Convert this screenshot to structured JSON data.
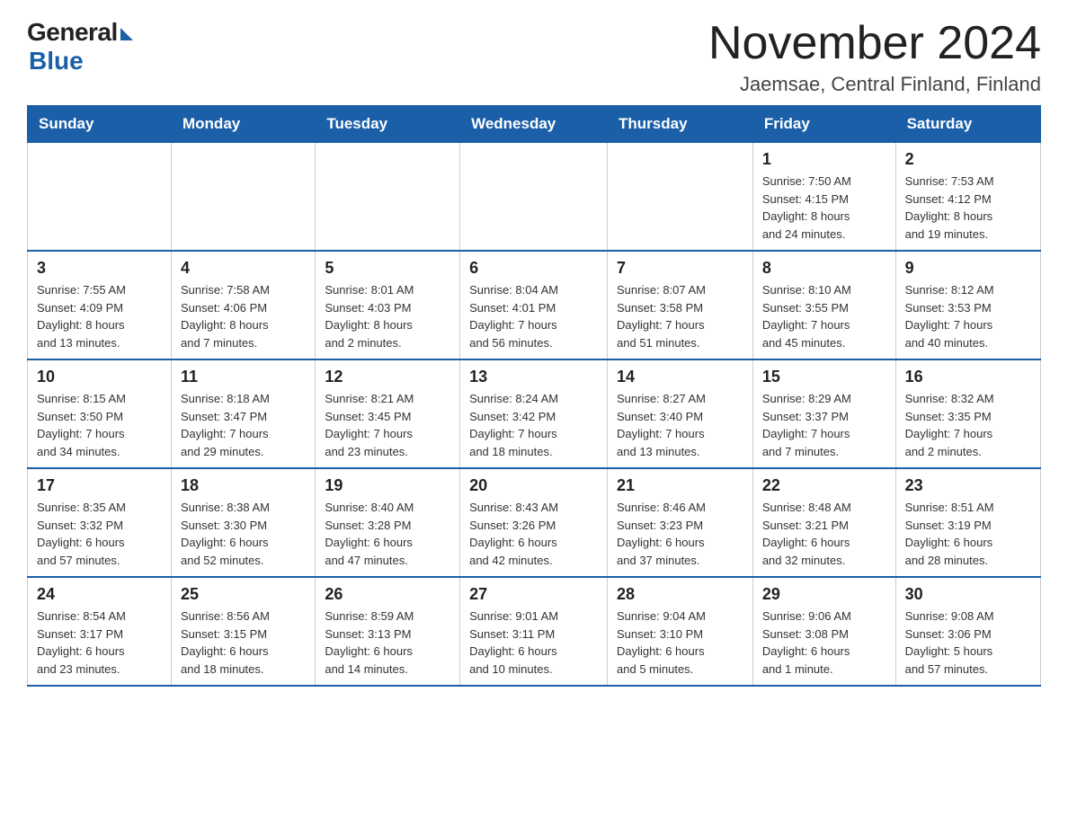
{
  "logo": {
    "general": "General",
    "blue": "Blue"
  },
  "header": {
    "title": "November 2024",
    "subtitle": "Jaemsae, Central Finland, Finland"
  },
  "weekdays": [
    "Sunday",
    "Monday",
    "Tuesday",
    "Wednesday",
    "Thursday",
    "Friday",
    "Saturday"
  ],
  "weeks": [
    [
      {
        "day": "",
        "info": ""
      },
      {
        "day": "",
        "info": ""
      },
      {
        "day": "",
        "info": ""
      },
      {
        "day": "",
        "info": ""
      },
      {
        "day": "",
        "info": ""
      },
      {
        "day": "1",
        "info": "Sunrise: 7:50 AM\nSunset: 4:15 PM\nDaylight: 8 hours\nand 24 minutes."
      },
      {
        "day": "2",
        "info": "Sunrise: 7:53 AM\nSunset: 4:12 PM\nDaylight: 8 hours\nand 19 minutes."
      }
    ],
    [
      {
        "day": "3",
        "info": "Sunrise: 7:55 AM\nSunset: 4:09 PM\nDaylight: 8 hours\nand 13 minutes."
      },
      {
        "day": "4",
        "info": "Sunrise: 7:58 AM\nSunset: 4:06 PM\nDaylight: 8 hours\nand 7 minutes."
      },
      {
        "day": "5",
        "info": "Sunrise: 8:01 AM\nSunset: 4:03 PM\nDaylight: 8 hours\nand 2 minutes."
      },
      {
        "day": "6",
        "info": "Sunrise: 8:04 AM\nSunset: 4:01 PM\nDaylight: 7 hours\nand 56 minutes."
      },
      {
        "day": "7",
        "info": "Sunrise: 8:07 AM\nSunset: 3:58 PM\nDaylight: 7 hours\nand 51 minutes."
      },
      {
        "day": "8",
        "info": "Sunrise: 8:10 AM\nSunset: 3:55 PM\nDaylight: 7 hours\nand 45 minutes."
      },
      {
        "day": "9",
        "info": "Sunrise: 8:12 AM\nSunset: 3:53 PM\nDaylight: 7 hours\nand 40 minutes."
      }
    ],
    [
      {
        "day": "10",
        "info": "Sunrise: 8:15 AM\nSunset: 3:50 PM\nDaylight: 7 hours\nand 34 minutes."
      },
      {
        "day": "11",
        "info": "Sunrise: 8:18 AM\nSunset: 3:47 PM\nDaylight: 7 hours\nand 29 minutes."
      },
      {
        "day": "12",
        "info": "Sunrise: 8:21 AM\nSunset: 3:45 PM\nDaylight: 7 hours\nand 23 minutes."
      },
      {
        "day": "13",
        "info": "Sunrise: 8:24 AM\nSunset: 3:42 PM\nDaylight: 7 hours\nand 18 minutes."
      },
      {
        "day": "14",
        "info": "Sunrise: 8:27 AM\nSunset: 3:40 PM\nDaylight: 7 hours\nand 13 minutes."
      },
      {
        "day": "15",
        "info": "Sunrise: 8:29 AM\nSunset: 3:37 PM\nDaylight: 7 hours\nand 7 minutes."
      },
      {
        "day": "16",
        "info": "Sunrise: 8:32 AM\nSunset: 3:35 PM\nDaylight: 7 hours\nand 2 minutes."
      }
    ],
    [
      {
        "day": "17",
        "info": "Sunrise: 8:35 AM\nSunset: 3:32 PM\nDaylight: 6 hours\nand 57 minutes."
      },
      {
        "day": "18",
        "info": "Sunrise: 8:38 AM\nSunset: 3:30 PM\nDaylight: 6 hours\nand 52 minutes."
      },
      {
        "day": "19",
        "info": "Sunrise: 8:40 AM\nSunset: 3:28 PM\nDaylight: 6 hours\nand 47 minutes."
      },
      {
        "day": "20",
        "info": "Sunrise: 8:43 AM\nSunset: 3:26 PM\nDaylight: 6 hours\nand 42 minutes."
      },
      {
        "day": "21",
        "info": "Sunrise: 8:46 AM\nSunset: 3:23 PM\nDaylight: 6 hours\nand 37 minutes."
      },
      {
        "day": "22",
        "info": "Sunrise: 8:48 AM\nSunset: 3:21 PM\nDaylight: 6 hours\nand 32 minutes."
      },
      {
        "day": "23",
        "info": "Sunrise: 8:51 AM\nSunset: 3:19 PM\nDaylight: 6 hours\nand 28 minutes."
      }
    ],
    [
      {
        "day": "24",
        "info": "Sunrise: 8:54 AM\nSunset: 3:17 PM\nDaylight: 6 hours\nand 23 minutes."
      },
      {
        "day": "25",
        "info": "Sunrise: 8:56 AM\nSunset: 3:15 PM\nDaylight: 6 hours\nand 18 minutes."
      },
      {
        "day": "26",
        "info": "Sunrise: 8:59 AM\nSunset: 3:13 PM\nDaylight: 6 hours\nand 14 minutes."
      },
      {
        "day": "27",
        "info": "Sunrise: 9:01 AM\nSunset: 3:11 PM\nDaylight: 6 hours\nand 10 minutes."
      },
      {
        "day": "28",
        "info": "Sunrise: 9:04 AM\nSunset: 3:10 PM\nDaylight: 6 hours\nand 5 minutes."
      },
      {
        "day": "29",
        "info": "Sunrise: 9:06 AM\nSunset: 3:08 PM\nDaylight: 6 hours\nand 1 minute."
      },
      {
        "day": "30",
        "info": "Sunrise: 9:08 AM\nSunset: 3:06 PM\nDaylight: 5 hours\nand 57 minutes."
      }
    ]
  ]
}
